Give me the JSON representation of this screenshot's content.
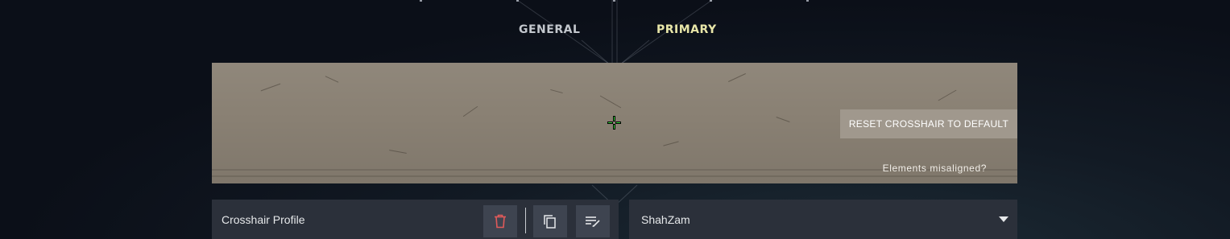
{
  "tabs": [
    {
      "label": "GENERAL",
      "active": false
    },
    {
      "label": "PRIMARY",
      "active": true
    }
  ],
  "colors": {
    "tab_inactive": "#c3c7cd",
    "tab_active": "#e8e6a8",
    "crosshair": "#33e03a",
    "delete_icon": "#e05a5a"
  },
  "preview": {
    "reset_label": "RESET CROSSHAIR TO DEFAULT",
    "misaligned_link": "Elements misaligned?"
  },
  "profile": {
    "label": "Crosshair Profile",
    "selected": "ShahZam",
    "icons": {
      "delete": "trash-icon",
      "copy": "copy-icon",
      "edit": "rename-icon",
      "dropdown": "chevron-down-icon"
    }
  }
}
